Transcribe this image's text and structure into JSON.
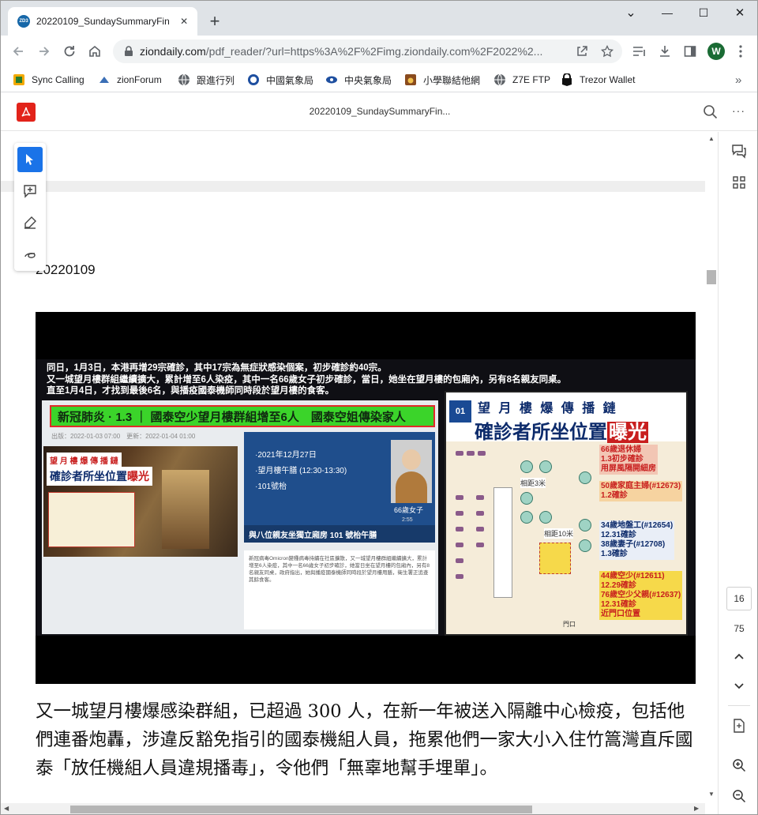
{
  "browser": {
    "tab": {
      "favicon_text": "ZD3",
      "title": "20220109_SundaySummaryFin",
      "close_glyph": "✕"
    },
    "new_tab_glyph": "+",
    "window_controls": {
      "caret": "⌄",
      "minimize": "—",
      "maximize": "☐",
      "close": "✕"
    },
    "url": {
      "host": "ziondaily.com",
      "rest": "/pdf_reader/?url=https%3A%2F%2Fimg.ziondaily.com%2F2022%2..."
    },
    "profile_initial": "W",
    "bookmarks": [
      {
        "label": "Sync Calling",
        "icon": "sync-calling-icon"
      },
      {
        "label": "zionForum",
        "icon": "zionforum-icon"
      },
      {
        "label": "跟進行列",
        "icon": "globe-icon"
      },
      {
        "label": "中國氣象局",
        "icon": "cma-icon"
      },
      {
        "label": "中央氣象局",
        "icon": "cwb-icon"
      },
      {
        "label": "小學聯結他網",
        "icon": "guitar-icon"
      },
      {
        "label": "Z7E FTP",
        "icon": "globe-icon"
      },
      {
        "label": "Trezor Wallet",
        "icon": "trezor-icon"
      }
    ],
    "bookmarks_overflow": "»"
  },
  "pdf_viewer": {
    "title": "20220109_SundaySummaryFin...",
    "more_glyph": "···",
    "page_current": "16",
    "page_total": "75"
  },
  "document": {
    "date": "20220109",
    "paragraph": "又一城望月樓爆感染群組，已超過 300 人，在新一年被送入隔離中心檢疫，包括他們連番炮轟，涉違反豁免指引的國泰機組人員，拖累他們一家大小入住竹篙灣直斥國泰「放任機組人員違規播毒」，令他們「無辜地幫手埋單」。"
  },
  "video_frame": {
    "captions": [
      "同日，1月3日，本港再增29宗確診，其中17宗為無症狀感染個案，初步確診約40宗。",
      "又一城望月樓群組繼續擴大，累計增至6人染疫，其中一名66歲女子初步確診，當日，她坐在望月樓的包廂內，另有8名親友同桌。",
      "直至1月4日，才找到最後6名，與播疫國泰機師同時段於望月樓的食客。"
    ],
    "headline": "新冠肺炎 · 1.3 ｜ 國泰空少望月樓群組增至6人　國泰空姐傳染家人",
    "meta": "出版：2022-01-03 07:00　更新：2022-01-04 01:00",
    "photo_title_top": "望 月 樓 爆 傳 播 鏈",
    "photo_title_main": "確診者所坐位置",
    "photo_title_highlight": "曝光",
    "blue_lines": [
      "·2021年12月27日",
      "·望月樓午膳 (12:30-13:30)",
      "·101號枱"
    ],
    "old_lady_label": "66歲女子",
    "video_time": "2:55",
    "blue_caption": "與八位親友坐獨立廂房 101 號枱午膳",
    "article_text": "新冠病毒Omicron變種病毒持續在社區擴散，又一城望月樓群組繼續擴大，累計增至6人染疫，其中一名66歲女子初步確診，她當日坐在望月樓的包廂內，另有8名親友同桌，政府指出，她與播疫國泰機師同時段於望月樓用膳，衛生署正追查其餘食客。",
    "right_title_top": "望 月 樓 爆 傳 播 鏈",
    "right_title_main": "確診者所坐位置",
    "right_title_highlight": "曝光",
    "logo_text": "01",
    "right_tags": [
      "66歲退休婦\n1.3初步確診\n用屏風隔開細房",
      "50歲家庭主婦(#12673)\n1.2確診",
      "34歲地盤工(#12654)\n12.31確診\n38歲妻子(#12708)\n1.3確診",
      "44歲空少(#12611)\n12.29確診\n76歲空少父親(#12637)\n12.31確診\n近門口位置"
    ],
    "map_labels": [
      "相距3米",
      "相距10米",
      "門口"
    ]
  },
  "colors": {
    "accent": "#1a73e8",
    "pdf_red": "#e2231a",
    "profile_green": "#1a6b34"
  }
}
